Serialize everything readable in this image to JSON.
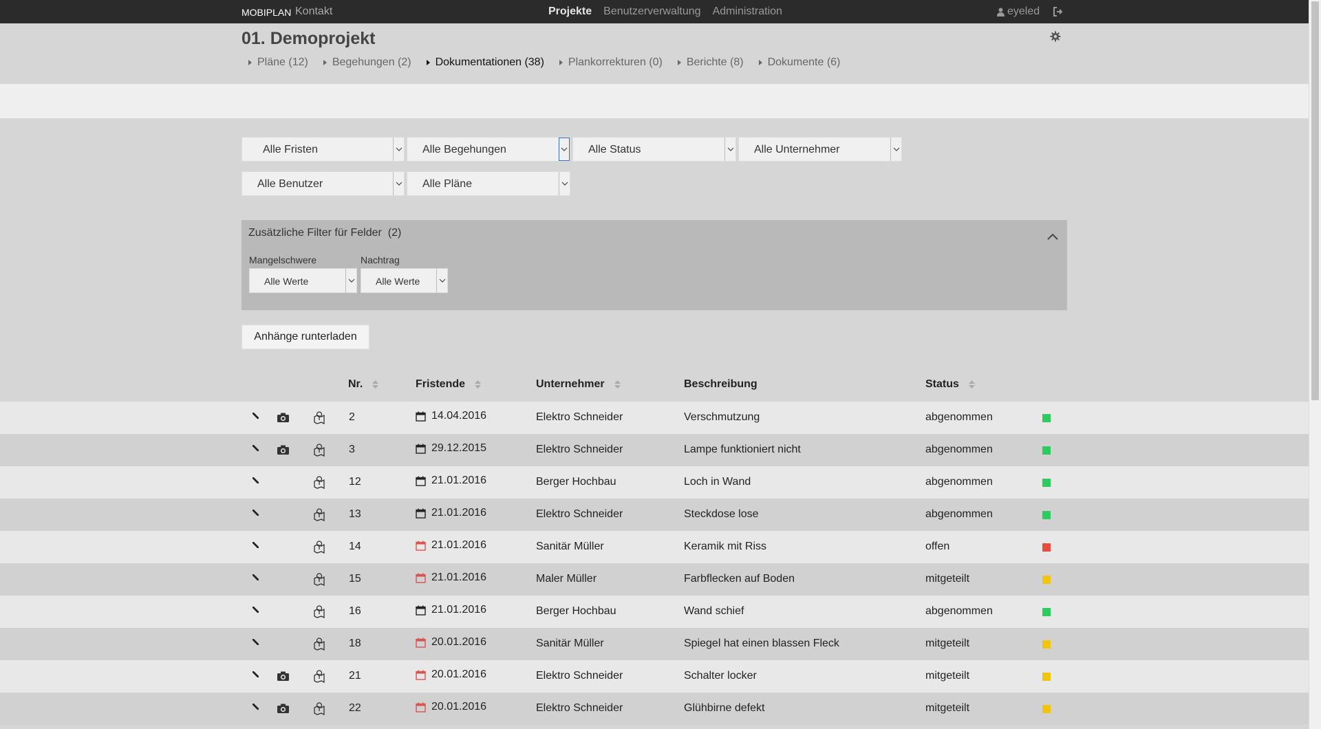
{
  "navbar": {
    "brand": "MOBIPLAN",
    "kontakt": "Kontakt",
    "center_items": [
      {
        "label": "Projekte",
        "active": true
      },
      {
        "label": "Benutzerverwaltung",
        "active": false
      },
      {
        "label": "Administration",
        "active": false
      }
    ],
    "user": "eyeled",
    "user_icon": "user-icon",
    "logout_icon": "logout-icon"
  },
  "project": {
    "title": "01. Demoprojekt",
    "settings_icon": "gear-icon",
    "tabs": [
      {
        "label": "Pläne (12)",
        "active": false
      },
      {
        "label": "Begehungen (2)",
        "active": false
      },
      {
        "label": "Dokumentationen (38)",
        "active": true
      },
      {
        "label": "Plankorrekturen (0)",
        "active": false
      },
      {
        "label": "Berichte (8)",
        "active": false
      },
      {
        "label": "Dokumente (6)",
        "active": false
      }
    ]
  },
  "filters": {
    "fristen": "Alle Fristen",
    "begehungen": "Alle Begehungen",
    "status": "Alle Status",
    "unternehmer": "Alle Unternehmer",
    "benutzer": "Alle Benutzer",
    "plaene": "Alle Pläne"
  },
  "extra_filters": {
    "title": "Zusätzliche Filter für Felder",
    "count": "(2)",
    "fields": [
      {
        "label": "Mangelschwere",
        "value": "Alle Werte"
      },
      {
        "label": "Nachtrag",
        "value": "Alle Werte"
      }
    ]
  },
  "download_button": "Anhänge runterladen",
  "table": {
    "headers": {
      "nr": "Nr.",
      "fristende": "Fristende",
      "unternehmer": "Unternehmer",
      "beschreibung": "Beschreibung",
      "status": "Status"
    },
    "rows": [
      {
        "has_photo": true,
        "nr": "2",
        "date": "14.04.2016",
        "date_overdue": false,
        "unternehmer": "Elektro Schneider",
        "beschreibung": "Verschmutzung",
        "status": "abgenommen",
        "status_color": "#2ecc5f"
      },
      {
        "has_photo": true,
        "nr": "3",
        "date": "29.12.2015",
        "date_overdue": false,
        "unternehmer": "Elektro Schneider",
        "beschreibung": "Lampe funktioniert nicht",
        "status": "abgenommen",
        "status_color": "#2ecc5f"
      },
      {
        "has_photo": false,
        "nr": "12",
        "date": "21.01.2016",
        "date_overdue": false,
        "unternehmer": "Berger Hochbau",
        "beschreibung": "Loch in Wand",
        "status": "abgenommen",
        "status_color": "#2ecc5f"
      },
      {
        "has_photo": false,
        "nr": "13",
        "date": "21.01.2016",
        "date_overdue": false,
        "unternehmer": "Elektro Schneider",
        "beschreibung": "Steckdose lose",
        "status": "abgenommen",
        "status_color": "#2ecc5f"
      },
      {
        "has_photo": false,
        "nr": "14",
        "date": "21.01.2016",
        "date_overdue": true,
        "unternehmer": "Sanitär Müller",
        "beschreibung": "Keramik mit Riss",
        "status": "offen",
        "status_color": "#e74c3c"
      },
      {
        "has_photo": false,
        "nr": "15",
        "date": "21.01.2016",
        "date_overdue": true,
        "unternehmer": "Maler Müller",
        "beschreibung": "Farbflecken auf Boden",
        "status": "mitgeteilt",
        "status_color": "#f1c40f"
      },
      {
        "has_photo": false,
        "nr": "16",
        "date": "21.01.2016",
        "date_overdue": false,
        "unternehmer": "Berger Hochbau",
        "beschreibung": "Wand schief",
        "status": "abgenommen",
        "status_color": "#2ecc5f"
      },
      {
        "has_photo": false,
        "nr": "18",
        "date": "20.01.2016",
        "date_overdue": true,
        "unternehmer": "Sanitär Müller",
        "beschreibung": "Spiegel hat einen blassen Fleck",
        "status": "mitgeteilt",
        "status_color": "#f1c40f"
      },
      {
        "has_photo": true,
        "nr": "21",
        "date": "20.01.2016",
        "date_overdue": true,
        "unternehmer": "Elektro Schneider",
        "beschreibung": "Schalter locker",
        "status": "mitgeteilt",
        "status_color": "#f1c40f"
      },
      {
        "has_photo": true,
        "nr": "22",
        "date": "20.01.2016",
        "date_overdue": true,
        "unternehmer": "Elektro Schneider",
        "beschreibung": "Glühbirne defekt",
        "status": "mitgeteilt",
        "status_color": "#f1c40f"
      }
    ]
  }
}
